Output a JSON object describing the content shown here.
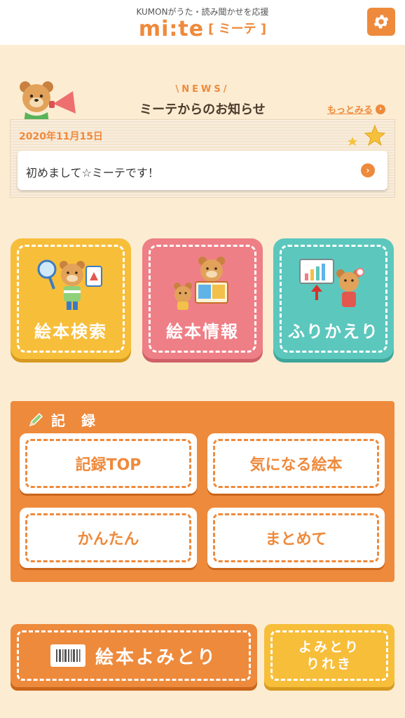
{
  "header": {
    "tagline": "KUMONがうた・読み聞かせを応援",
    "logo_main": "mi:te",
    "logo_sub": "[ ミーテ ]",
    "settings_icon": "gear-icon"
  },
  "news": {
    "tag": "\\NEWS/",
    "title": "ミーテからのお知らせ",
    "more_label": "もっとみる",
    "date": "2020年11月15日",
    "item_text": "初めまして☆ミーテです！"
  },
  "tiles": [
    {
      "label": "絵本検索",
      "color": "#f7be3a"
    },
    {
      "label": "絵本情報",
      "color": "#ee7f86"
    },
    {
      "label": "ふりかえり",
      "color": "#5cc7bd"
    }
  ],
  "record": {
    "title": "記 録",
    "buttons": [
      "記録TOP",
      "気になる絵本",
      "かんたん",
      "まとめて"
    ]
  },
  "bottom": {
    "scan_label": "絵本よみとり",
    "history_line1": "よみとり",
    "history_line2": "りれき"
  },
  "colors": {
    "accent": "#ee8a3c",
    "background": "#fcecd2"
  }
}
